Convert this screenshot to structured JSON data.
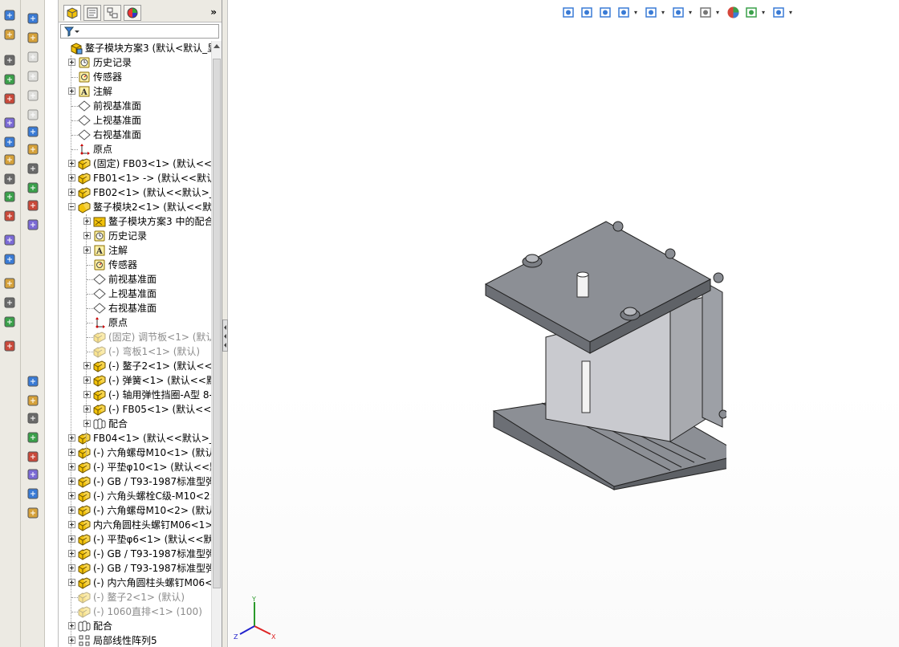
{
  "feature_tree": {
    "items": [
      {
        "label": "鳌子模块方案3 (默认<默认_显",
        "level": 0,
        "icon": "assembly-icon",
        "expander": "none",
        "dim": false
      },
      {
        "label": "历史记录",
        "level": 1,
        "icon": "history-icon",
        "expander": "plus",
        "dim": false
      },
      {
        "label": "传感器",
        "level": 1,
        "icon": "sensor-icon",
        "expander": "none",
        "dim": false
      },
      {
        "label": "注解",
        "level": 1,
        "icon": "annotation-icon",
        "expander": "plus",
        "dim": false
      },
      {
        "label": "前视基准面",
        "level": 1,
        "icon": "plane-icon",
        "expander": "none",
        "dim": false
      },
      {
        "label": "上视基准面",
        "level": 1,
        "icon": "plane-icon",
        "expander": "none",
        "dim": false
      },
      {
        "label": "右视基准面",
        "level": 1,
        "icon": "plane-icon",
        "expander": "none",
        "dim": false
      },
      {
        "label": "原点",
        "level": 1,
        "icon": "origin-icon",
        "expander": "none",
        "dim": false
      },
      {
        "label": "(固定) FB03<1> (默认<<默",
        "level": 1,
        "icon": "part-icon",
        "expander": "plus",
        "dim": false
      },
      {
        "label": "FB01<1> -> (默认<<默认",
        "level": 1,
        "icon": "part-icon",
        "expander": "plus",
        "dim": false
      },
      {
        "label": "FB02<1> (默认<<默认>_外",
        "level": 1,
        "icon": "part-icon",
        "expander": "plus",
        "dim": false
      },
      {
        "label": "鳌子模块2<1> (默认<<默认",
        "level": 1,
        "icon": "subassembly-icon",
        "expander": "minus",
        "dim": false
      },
      {
        "label": "鳌子模块方案3 中的配合",
        "level": 2,
        "icon": "mates-folder-icon",
        "expander": "plus",
        "dim": false
      },
      {
        "label": "历史记录",
        "level": 2,
        "icon": "history-icon",
        "expander": "plus",
        "dim": false
      },
      {
        "label": "注解",
        "level": 2,
        "icon": "annotation-icon",
        "expander": "plus",
        "dim": false
      },
      {
        "label": "传感器",
        "level": 2,
        "icon": "sensor-icon",
        "expander": "none",
        "dim": false
      },
      {
        "label": "前视基准面",
        "level": 2,
        "icon": "plane-icon",
        "expander": "none",
        "dim": false
      },
      {
        "label": "上视基准面",
        "level": 2,
        "icon": "plane-icon",
        "expander": "none",
        "dim": false
      },
      {
        "label": "右视基准面",
        "level": 2,
        "icon": "plane-icon",
        "expander": "none",
        "dim": false
      },
      {
        "label": "原点",
        "level": 2,
        "icon": "origin-icon",
        "expander": "none",
        "dim": false
      },
      {
        "label": "(固定) 调节板<1> (默认",
        "level": 2,
        "icon": "part-icon",
        "expander": "none",
        "dim": true
      },
      {
        "label": "(-) 弯板1<1> (默认)",
        "level": 2,
        "icon": "part-icon",
        "expander": "none",
        "dim": true
      },
      {
        "label": "(-) 鳌子2<1> (默认<<默",
        "level": 2,
        "icon": "part-icon",
        "expander": "plus",
        "dim": false
      },
      {
        "label": "(-) 弹簧<1> (默认<<默",
        "level": 2,
        "icon": "part-icon",
        "expander": "plus",
        "dim": false
      },
      {
        "label": "(-) 轴用弹性挡圈-A型 8-",
        "level": 2,
        "icon": "part-icon",
        "expander": "plus",
        "dim": false
      },
      {
        "label": "(-) FB05<1> (默认<<默",
        "level": 2,
        "icon": "part-icon",
        "expander": "plus",
        "dim": false
      },
      {
        "label": "配合",
        "level": 2,
        "icon": "mates-icon",
        "expander": "plus",
        "dim": false
      },
      {
        "label": "FB04<1> (默认<<默认>_显",
        "level": 1,
        "icon": "part-icon",
        "expander": "plus",
        "dim": false
      },
      {
        "label": "(-) 六角螺母M10<1> (默认",
        "level": 1,
        "icon": "part-icon",
        "expander": "plus",
        "dim": false
      },
      {
        "label": "(-) 平垫φ10<1> (默认<<默",
        "level": 1,
        "icon": "part-icon",
        "expander": "plus",
        "dim": false
      },
      {
        "label": "(-) GB / T93-1987标准型弹",
        "level": 1,
        "icon": "part-icon",
        "expander": "plus",
        "dim": false
      },
      {
        "label": "(-) 六角头螺栓C级-M10<2:",
        "level": 1,
        "icon": "part-icon",
        "expander": "plus",
        "dim": false
      },
      {
        "label": "(-) 六角螺母M10<2> (默认",
        "level": 1,
        "icon": "part-icon",
        "expander": "plus",
        "dim": false
      },
      {
        "label": "内六角圆柱头螺钉M06<1>",
        "level": 1,
        "icon": "part-icon",
        "expander": "plus",
        "dim": false
      },
      {
        "label": "(-) 平垫φ6<1> (默认<<默认",
        "level": 1,
        "icon": "part-icon",
        "expander": "plus",
        "dim": false
      },
      {
        "label": "(-) GB / T93-1987标准型弹",
        "level": 1,
        "icon": "part-icon",
        "expander": "plus",
        "dim": false
      },
      {
        "label": "(-) GB / T93-1987标准型弹",
        "level": 1,
        "icon": "part-icon",
        "expander": "plus",
        "dim": false
      },
      {
        "label": "(-) 内六角圆柱头螺钉M06<",
        "level": 1,
        "icon": "part-icon",
        "expander": "plus",
        "dim": false
      },
      {
        "label": "(-) 鳌子2<1> (默认)",
        "level": 1,
        "icon": "part-icon",
        "expander": "none",
        "dim": true
      },
      {
        "label": "(-) 1060直排<1> (100)",
        "level": 1,
        "icon": "part-icon",
        "expander": "none",
        "dim": true
      },
      {
        "label": "配合",
        "level": 1,
        "icon": "mates-icon",
        "expander": "plus",
        "dim": false
      },
      {
        "label": "局部线性阵列5",
        "level": 1,
        "icon": "pattern-icon",
        "expander": "plus",
        "dim": false
      }
    ],
    "more_label": "»"
  },
  "feature_tabs": [
    "feature-manager-tab",
    "property-manager-tab",
    "configuration-manager-tab",
    "display-manager-tab"
  ],
  "view_toolbar": [
    "zoom-to-fit-icon",
    "zoom-area-icon",
    "previous-view-icon",
    "section-view-icon",
    "view-orientation-icon",
    "display-style-icon",
    "hide-show-icon",
    "appearance-icon",
    "scene-icon",
    "view-settings-icon"
  ],
  "triad": {
    "x": "X",
    "y": "Y",
    "z": "Z"
  },
  "colors": {
    "part_yellow": "#f2c20a",
    "model_gray": "#8a8d93",
    "panel_bg": "#eceae3"
  }
}
